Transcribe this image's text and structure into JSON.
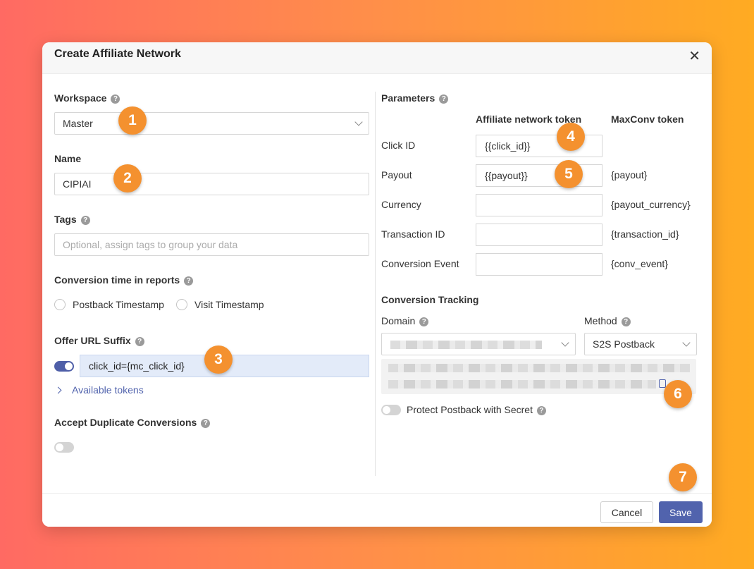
{
  "dialog": {
    "title": "Create Affiliate Network",
    "close": "✕"
  },
  "workspace": {
    "label": "Workspace",
    "help": "?",
    "value": "Master"
  },
  "name": {
    "label": "Name",
    "value": "CIPIAI"
  },
  "tags": {
    "label": "Tags",
    "help": "?",
    "placeholder": "Optional, assign tags to group your data"
  },
  "conversion_time": {
    "label": "Conversion time in reports",
    "help": "?",
    "options": [
      "Postback Timestamp",
      "Visit Timestamp"
    ]
  },
  "offer_url_suffix": {
    "label": "Offer URL Suffix",
    "help": "?",
    "value": "click_id={mc_click_id}",
    "enabled": true
  },
  "available_tokens": "Available tokens",
  "accept_duplicates": {
    "label": "Accept Duplicate Conversions",
    "help": "?",
    "enabled": false
  },
  "parameters": {
    "label": "Parameters",
    "help": "?",
    "col_affiliate": "Affiliate network token",
    "col_maxconv": "MaxConv token",
    "rows": [
      {
        "label": "Click ID",
        "value": "{{click_id}}",
        "token": ""
      },
      {
        "label": "Payout",
        "value": "{{payout}}",
        "token": "{payout}"
      },
      {
        "label": "Currency",
        "value": "",
        "token": "{payout_currency}"
      },
      {
        "label": "Transaction ID",
        "value": "",
        "token": "{transaction_id}"
      },
      {
        "label": "Conversion Event",
        "value": "",
        "token": "{conv_event}"
      }
    ]
  },
  "conversion_tracking": {
    "label": "Conversion Tracking",
    "domain_label": "Domain",
    "domain_help": "?",
    "method_label": "Method",
    "method_help": "?",
    "method_value": "S2S Postback"
  },
  "protect_postback": {
    "label": "Protect Postback with Secret",
    "help": "?",
    "enabled": false
  },
  "footer": {
    "cancel": "Cancel",
    "save": "Save"
  },
  "badges": [
    "1",
    "2",
    "3",
    "4",
    "5",
    "6",
    "7"
  ],
  "colors": {
    "primary": "#5163ad",
    "badge": "#f4912f"
  }
}
